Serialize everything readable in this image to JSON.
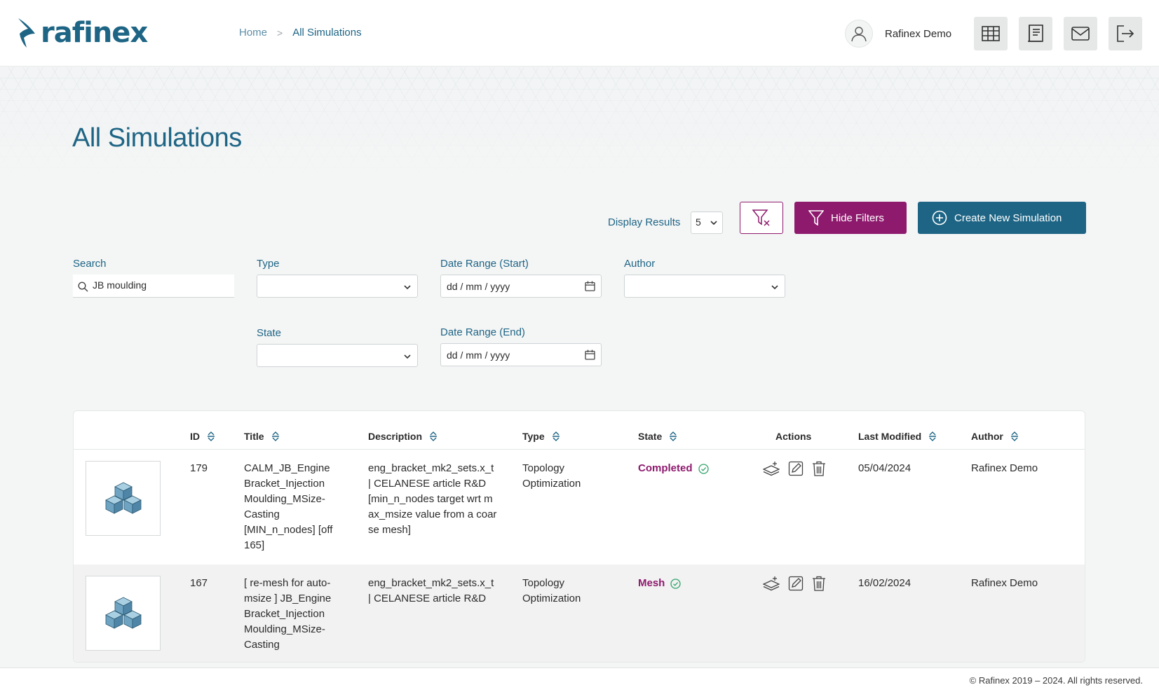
{
  "header": {
    "logo_text": "rafinex",
    "breadcrumb": {
      "home": "Home",
      "separator": ">",
      "current": "All Simulations"
    },
    "user_name": "Rafinex Demo",
    "icons": [
      "table-icon",
      "notebook-icon",
      "mail-icon",
      "logout-icon"
    ]
  },
  "page": {
    "title": "All Simulations"
  },
  "toolbar": {
    "display_label": "Display Results",
    "display_value": "5",
    "hide_filters_label": "Hide Filters",
    "create_label": "Create New Simulation"
  },
  "filters": {
    "search": {
      "label": "Search",
      "value": "JB moulding"
    },
    "type": {
      "label": "Type",
      "value": ""
    },
    "date_start": {
      "label": "Date Range (Start)",
      "placeholder": "dd / mm / yyyy"
    },
    "author": {
      "label": "Author",
      "value": ""
    },
    "state": {
      "label": "State",
      "value": ""
    },
    "date_end": {
      "label": "Date Range (End)",
      "placeholder": "dd / mm / yyyy"
    }
  },
  "table": {
    "columns": {
      "id": "ID",
      "title": "Title",
      "description": "Description",
      "type": "Type",
      "state": "State",
      "actions": "Actions",
      "last_modified": "Last Modified",
      "author": "Author"
    },
    "rows": [
      {
        "id": "179",
        "title": "CALM_JB_Engine Bracket_Injection Moulding_MSize-Casting [MIN_n_nodes] [off 165]",
        "description": "eng_bracket_mk2_sets.x_t | CELANESE article R&D [min_n_nodes target wrt max_msize value from a coarse mesh]",
        "type": "Topology Optimization",
        "state": "Completed",
        "last_modified": "05/04/2024",
        "author": "Rafinex Demo"
      },
      {
        "id": "167",
        "title": "[ re-mesh for auto-msize ] JB_Engine Bracket_Injection Moulding_MSize-Casting",
        "description": "eng_bracket_mk2_sets.x_t | CELANESE article R&D",
        "type": "Topology Optimization",
        "state": "Mesh",
        "last_modified": "16/02/2024",
        "author": "Rafinex Demo"
      }
    ]
  },
  "footer": {
    "text": "© Rafinex 2019 – 2024. All rights reserved."
  },
  "colors": {
    "primary": "#1e6585",
    "accent": "#8e1a6e",
    "success": "#2fa36b"
  }
}
